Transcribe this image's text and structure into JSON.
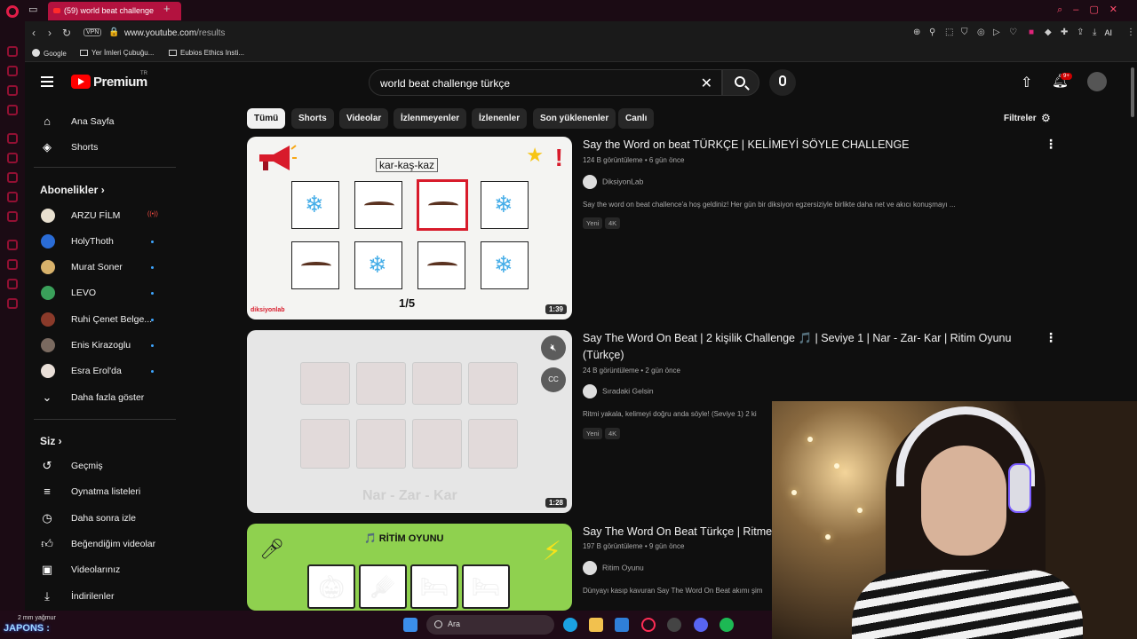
{
  "browser": {
    "tab_title": "(59) world beat challenge",
    "new_tab": "+",
    "vpn": "VPN",
    "url_host": "www.youtube.com",
    "url_path": "/results",
    "ai_label": "AI",
    "bookmarks": [
      {
        "label": "Google"
      },
      {
        "label": "Yer İmleri Çubuğu..."
      },
      {
        "label": "Eubios Ethics Insti..."
      }
    ]
  },
  "youtube": {
    "brand": "Premium",
    "region": "TR",
    "search_value": "world beat challenge türkçe",
    "notif_count": "9+",
    "nav_main": [
      {
        "label": "Ana Sayfa",
        "icon": "home-icon"
      },
      {
        "label": "Shorts",
        "icon": "shorts-icon"
      }
    ],
    "subs_title": "Abonelikler",
    "subscriptions": [
      {
        "label": "ARZU FİLM",
        "color": "#e8e0d0",
        "live": true
      },
      {
        "label": "HolyThoth",
        "color": "#2a6cd6"
      },
      {
        "label": "Murat Soner",
        "color": "#d8b26b"
      },
      {
        "label": "LEVO",
        "color": "#3aa05a"
      },
      {
        "label": "Ruhi Çenet Belge...",
        "color": "#8a3a2a"
      },
      {
        "label": "Enis Kirazoglu",
        "color": "#7a6a60"
      },
      {
        "label": "Esra Erol'da",
        "color": "#e9dfd8"
      }
    ],
    "show_more": "Daha fazla göster",
    "you_title": "Siz",
    "you_items": [
      {
        "label": "Geçmiş",
        "icon": "history-icon"
      },
      {
        "label": "Oynatma listeleri",
        "icon": "playlists-icon"
      },
      {
        "label": "Daha sonra izle",
        "icon": "watch-later-icon"
      },
      {
        "label": "Beğendiğim videolar",
        "icon": "liked-icon"
      },
      {
        "label": "Videolarınız",
        "icon": "your-videos-icon"
      },
      {
        "label": "İndirilenler",
        "icon": "downloads-icon"
      }
    ],
    "chips": [
      "Tümü",
      "Shorts",
      "Videolar",
      "İzlenmeyenler",
      "İzlenenler",
      "Son yüklenenler",
      "Canlı"
    ],
    "filters": "Filtreler",
    "results": [
      {
        "title": "Say the Word on beat TÜRKÇE | KELİMEYİ SÖYLE CHALLENGE",
        "meta": "124 B görüntüleme • 6 gün önce",
        "channel": "DiksiyonLab",
        "desc": "Say the word on beat challence'a hoş geldiniz! Her gün bir diksiyon egzersiziyle birlikte daha net ve akıcı konuşmayı ...",
        "badges": [
          "Yeni",
          "4K"
        ],
        "duration": "1:39",
        "thumb_caption": "kar-kaş-kaz",
        "thumb_pager": "1/5",
        "thumb_brand": "diksiyonlab"
      },
      {
        "title": "Say The Word On Beat | 2 kişilik Challenge 🎵 | Seviye 1 | Nar - Zar- Kar | Ritim Oyunu (Türkçe)",
        "meta": "24 B görüntüleme • 2 gün önce",
        "channel": "Sıradaki Gelsin",
        "desc": "Ritmi yakala, kelimeyi doğru anda söyle! (Seviye 1) 2 ki",
        "badges": [
          "Yeni",
          "4K"
        ],
        "duration": "1:28",
        "thumb_label": "Nar - Zar - Kar",
        "cc": "CC"
      },
      {
        "title": "Say The Word On Beat Türkçe | Ritme",
        "meta": "197 B görüntüleme • 9 gün önce",
        "channel": "Ritim Oyunu",
        "desc": "Dünyayı kasıp kavuran Say The Word On Beat akımı şim",
        "thumb_banner": "🎵 RİTİM OYUNU"
      }
    ]
  },
  "taskbar": {
    "weather": "2 mm yağmur",
    "search": "Ara",
    "overlay": "JAPONS :"
  }
}
